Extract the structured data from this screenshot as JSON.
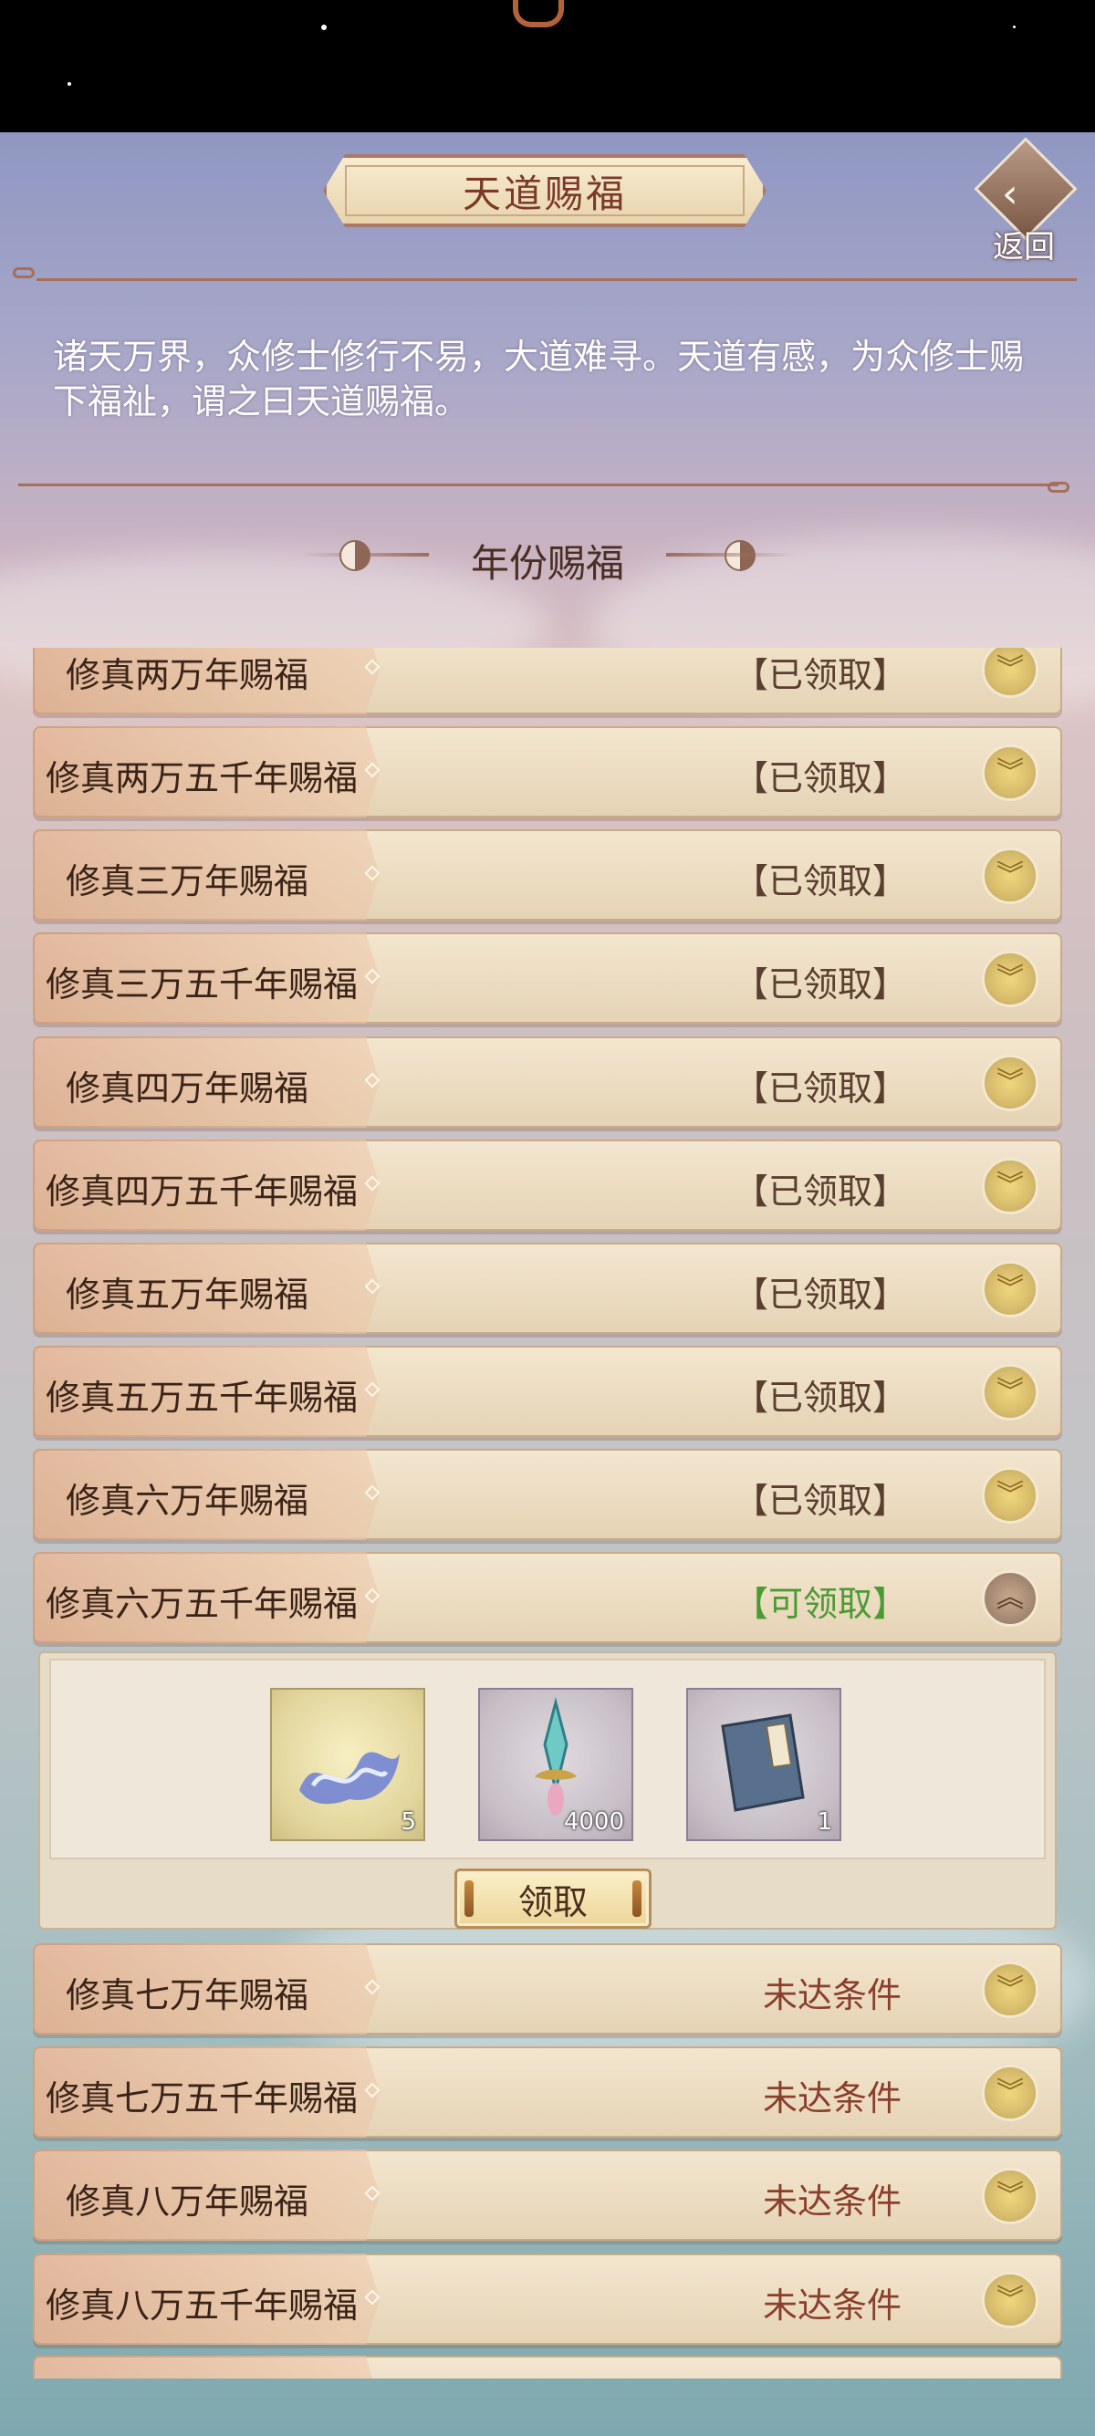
{
  "header": {
    "title": "天道赐福",
    "back_label": "返回"
  },
  "description": "诸天万界，众修士修行不易，大道难寻。天道有感，为众修士赐下福祉，谓之曰天道赐福。",
  "section_title": "年份赐福",
  "rows": [
    {
      "name": "修真两万年赐福",
      "status": "【已领取】",
      "state": "claimed"
    },
    {
      "name": "修真两万五千年赐福",
      "status": "【已领取】",
      "state": "claimed"
    },
    {
      "name": "修真三万年赐福",
      "status": "【已领取】",
      "state": "claimed"
    },
    {
      "name": "修真三万五千年赐福",
      "status": "【已领取】",
      "state": "claimed"
    },
    {
      "name": "修真四万年赐福",
      "status": "【已领取】",
      "state": "claimed"
    },
    {
      "name": "修真四万五千年赐福",
      "status": "【已领取】",
      "state": "claimed"
    },
    {
      "name": "修真五万年赐福",
      "status": "【已领取】",
      "state": "claimed"
    },
    {
      "name": "修真五万五千年赐福",
      "status": "【已领取】",
      "state": "claimed"
    },
    {
      "name": "修真六万年赐福",
      "status": "【已领取】",
      "state": "claimed"
    },
    {
      "name": "修真六万五千年赐福",
      "status": "【可领取】",
      "state": "claimable"
    },
    {
      "name": "修真七万年赐福",
      "status": "未达条件",
      "state": "locked"
    },
    {
      "name": "修真七万五千年赐福",
      "status": "未达条件",
      "state": "locked"
    },
    {
      "name": "修真八万年赐福",
      "status": "未达条件",
      "state": "locked"
    },
    {
      "name": "修真八万五千年赐福",
      "status": "未达条件",
      "state": "locked"
    }
  ],
  "rewards": [
    {
      "icon": "water-spirit-icon",
      "count": "5"
    },
    {
      "icon": "jade-sword-icon",
      "count": "4000"
    },
    {
      "icon": "manual-book-icon",
      "count": "1"
    }
  ],
  "claim_button": "领取",
  "colors": {
    "claimable": "#4c9a34",
    "locked": "#8a3e2c",
    "claimed": "#5a3e30",
    "title": "#7a3a2a"
  }
}
